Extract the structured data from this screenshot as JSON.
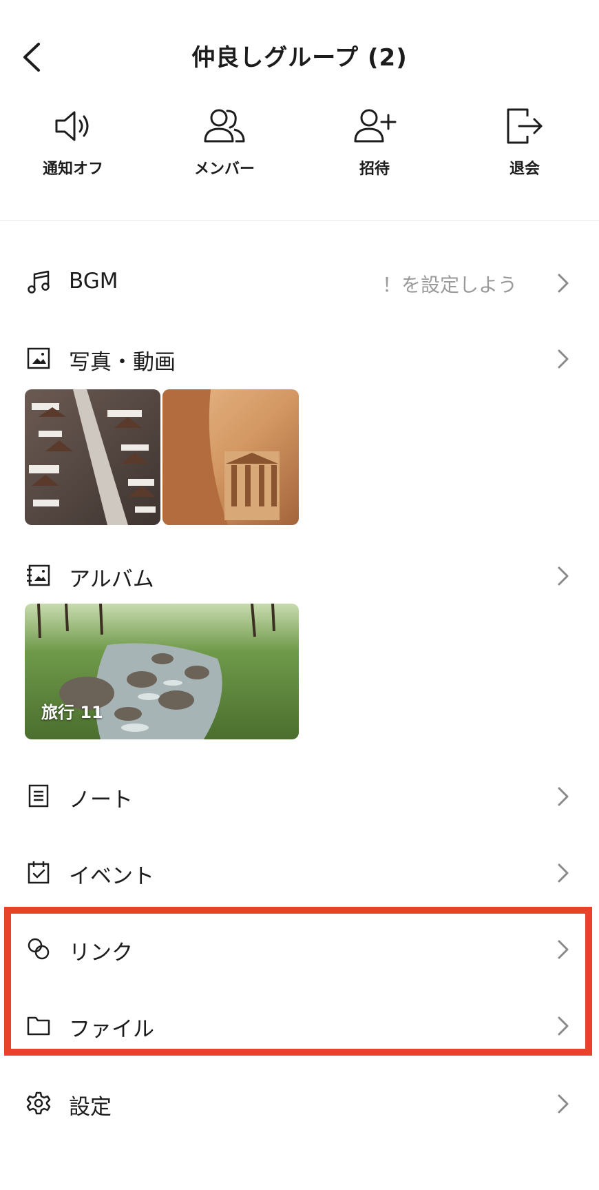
{
  "header": {
    "title": "仲良しグループ (2)"
  },
  "actions": [
    {
      "label": "通知オフ",
      "icon": "speaker-icon"
    },
    {
      "label": "メンバー",
      "icon": "members-icon"
    },
    {
      "label": "招待",
      "icon": "add-person-icon"
    },
    {
      "label": "退会",
      "icon": "exit-icon"
    }
  ],
  "menu": {
    "bgm": {
      "label": "BGM",
      "subtitle": "を設定しよう！"
    },
    "photos": {
      "label": "写真・動画"
    },
    "album": {
      "label": "アルバム",
      "item_label": "旅行 11"
    },
    "note": {
      "label": "ノート"
    },
    "event": {
      "label": "イベント"
    },
    "link": {
      "label": "リンク"
    },
    "file": {
      "label": "ファイル"
    },
    "settings": {
      "label": "設定"
    }
  },
  "colors": {
    "highlight": "#e8432a",
    "text": "#1c1c1c",
    "subtext": "#9a9a9a"
  }
}
